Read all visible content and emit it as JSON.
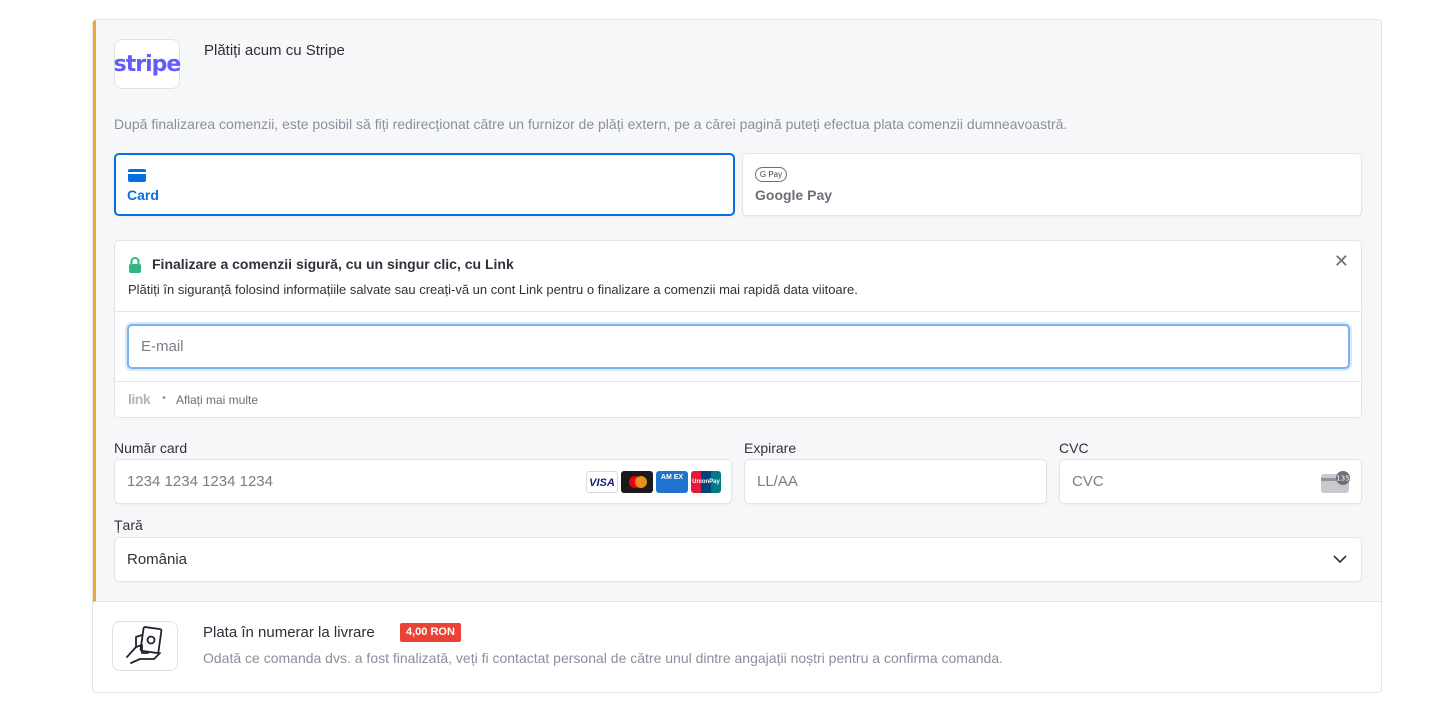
{
  "stripe": {
    "logo_text": "stripe",
    "title": "Plătiți acum cu Stripe",
    "description": "După finalizarea comenzii, este posibil să fiți redirecționat către un furnizor de plăți extern, pe a cărei pagină puteți efectua plata comenzii dumneavoastră.",
    "tabs": [
      {
        "label": "Card",
        "icon": "card-icon",
        "selected": true
      },
      {
        "label": "Google Pay",
        "icon": "google-pay-icon",
        "icon_text": "G Pay",
        "selected": false
      }
    ],
    "link": {
      "title": "Finalizare a comenzii sigură, cu un singur clic, cu Link",
      "subtitle": "Plătiți în siguranță folosind informațiile salvate sau creați-vă un cont Link pentru o finalizare a comenzii mai rapidă data viitoare.",
      "email_placeholder": "E-mail",
      "logo_text": "link",
      "separator": "•",
      "learn_more": "Aflați mai multe"
    },
    "fields": {
      "card_number_label": "Număr card",
      "card_number_placeholder": "1234 1234 1234 1234",
      "expiry_label": "Expirare",
      "expiry_placeholder": "LL/AA",
      "cvc_label": "CVC",
      "cvc_placeholder": "CVC",
      "cvc_icon_text": "135",
      "country_label": "Țară",
      "country_value": "România"
    },
    "brands": [
      {
        "name": "visa",
        "text": "VISA"
      },
      {
        "name": "mastercard",
        "text": ""
      },
      {
        "name": "amex",
        "text": "AM EX"
      },
      {
        "name": "unionpay",
        "text": "UnionPay"
      }
    ],
    "colors": {
      "accent": "#0570de",
      "stripe_brand": "#635bff",
      "left_border": "#f0a531",
      "lock": "#30b784"
    }
  },
  "cash": {
    "title": "Plata în numerar la livrare",
    "fee": "4,00 RON",
    "description": "Odată ce comanda dvs. a fost finalizată, veți fi contactat personal de către unul dintre angajații noștri pentru a confirma comanda.",
    "colors": {
      "fee_badge": "#ea4335"
    }
  }
}
